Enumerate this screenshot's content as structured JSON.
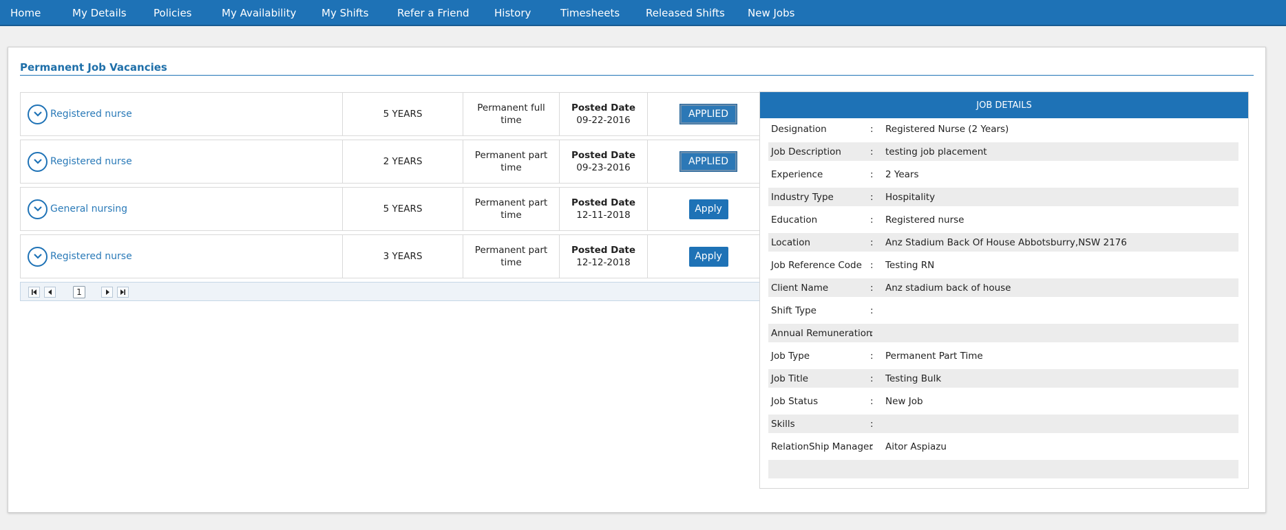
{
  "nav": [
    "Home",
    "My Details",
    "Policies",
    "My Availability",
    "My Shifts",
    "Refer a Friend",
    "History",
    "Timesheets",
    "Released Shifts",
    "New Jobs"
  ],
  "panel": {
    "title": "Permanent Job Vacancies"
  },
  "jobs": [
    {
      "title": "Registered nurse",
      "experience": "5 YEARS",
      "type": "Permanent full time",
      "posted_label": "Posted Date",
      "date": "09-22-2016",
      "action": "APPLIED",
      "action_state": "applied"
    },
    {
      "title": "Registered nurse",
      "experience": "2 YEARS",
      "type": "Permanent part time",
      "posted_label": "Posted Date",
      "date": "09-23-2016",
      "action": "APPLIED",
      "action_state": "applied"
    },
    {
      "title": "General nursing",
      "experience": "5 YEARS",
      "type": "Permanent part time",
      "posted_label": "Posted Date",
      "date": "12-11-2018",
      "action": "Apply",
      "action_state": "apply"
    },
    {
      "title": "Registered nurse",
      "experience": "3 YEARS",
      "type": "Permanent part time",
      "posted_label": "Posted Date",
      "date": "12-12-2018",
      "action": "Apply",
      "action_state": "apply"
    }
  ],
  "pager": {
    "page": "1"
  },
  "details": {
    "header": "JOB DETAILS",
    "separator": ":",
    "rows": [
      {
        "label": "Designation",
        "value": "Registered Nurse (2 Years)"
      },
      {
        "label": "Job Description",
        "value": "testing job placement"
      },
      {
        "label": "Experience",
        "value": "2 Years"
      },
      {
        "label": "Industry Type",
        "value": "Hospitality"
      },
      {
        "label": "Education",
        "value": "Registered nurse"
      },
      {
        "label": "Location",
        "value": "Anz Stadium Back Of House Abbotsburry,NSW 2176"
      },
      {
        "label": "Job Reference Code",
        "value": "Testing RN"
      },
      {
        "label": "Client Name",
        "value": "Anz stadium back of house"
      },
      {
        "label": "Shift Type",
        "value": ""
      },
      {
        "label": "Annual Remuneration",
        "value": ""
      },
      {
        "label": "Job Type",
        "value": "Permanent Part Time"
      },
      {
        "label": "Job Title",
        "value": "Testing Bulk"
      },
      {
        "label": "Job Status",
        "value": "New Job"
      },
      {
        "label": "Skills",
        "value": ""
      },
      {
        "label": "RelationShip Manager",
        "value": "Aitor Aspiazu"
      }
    ]
  },
  "colors": {
    "primary": "#1e72b6",
    "link": "#2a7ab8",
    "row_alt": "#ececec"
  },
  "icons": {
    "expand": "chevron-down-icon",
    "pager": [
      "first-page-icon",
      "prev-page-icon",
      "next-page-icon",
      "last-page-icon"
    ]
  }
}
